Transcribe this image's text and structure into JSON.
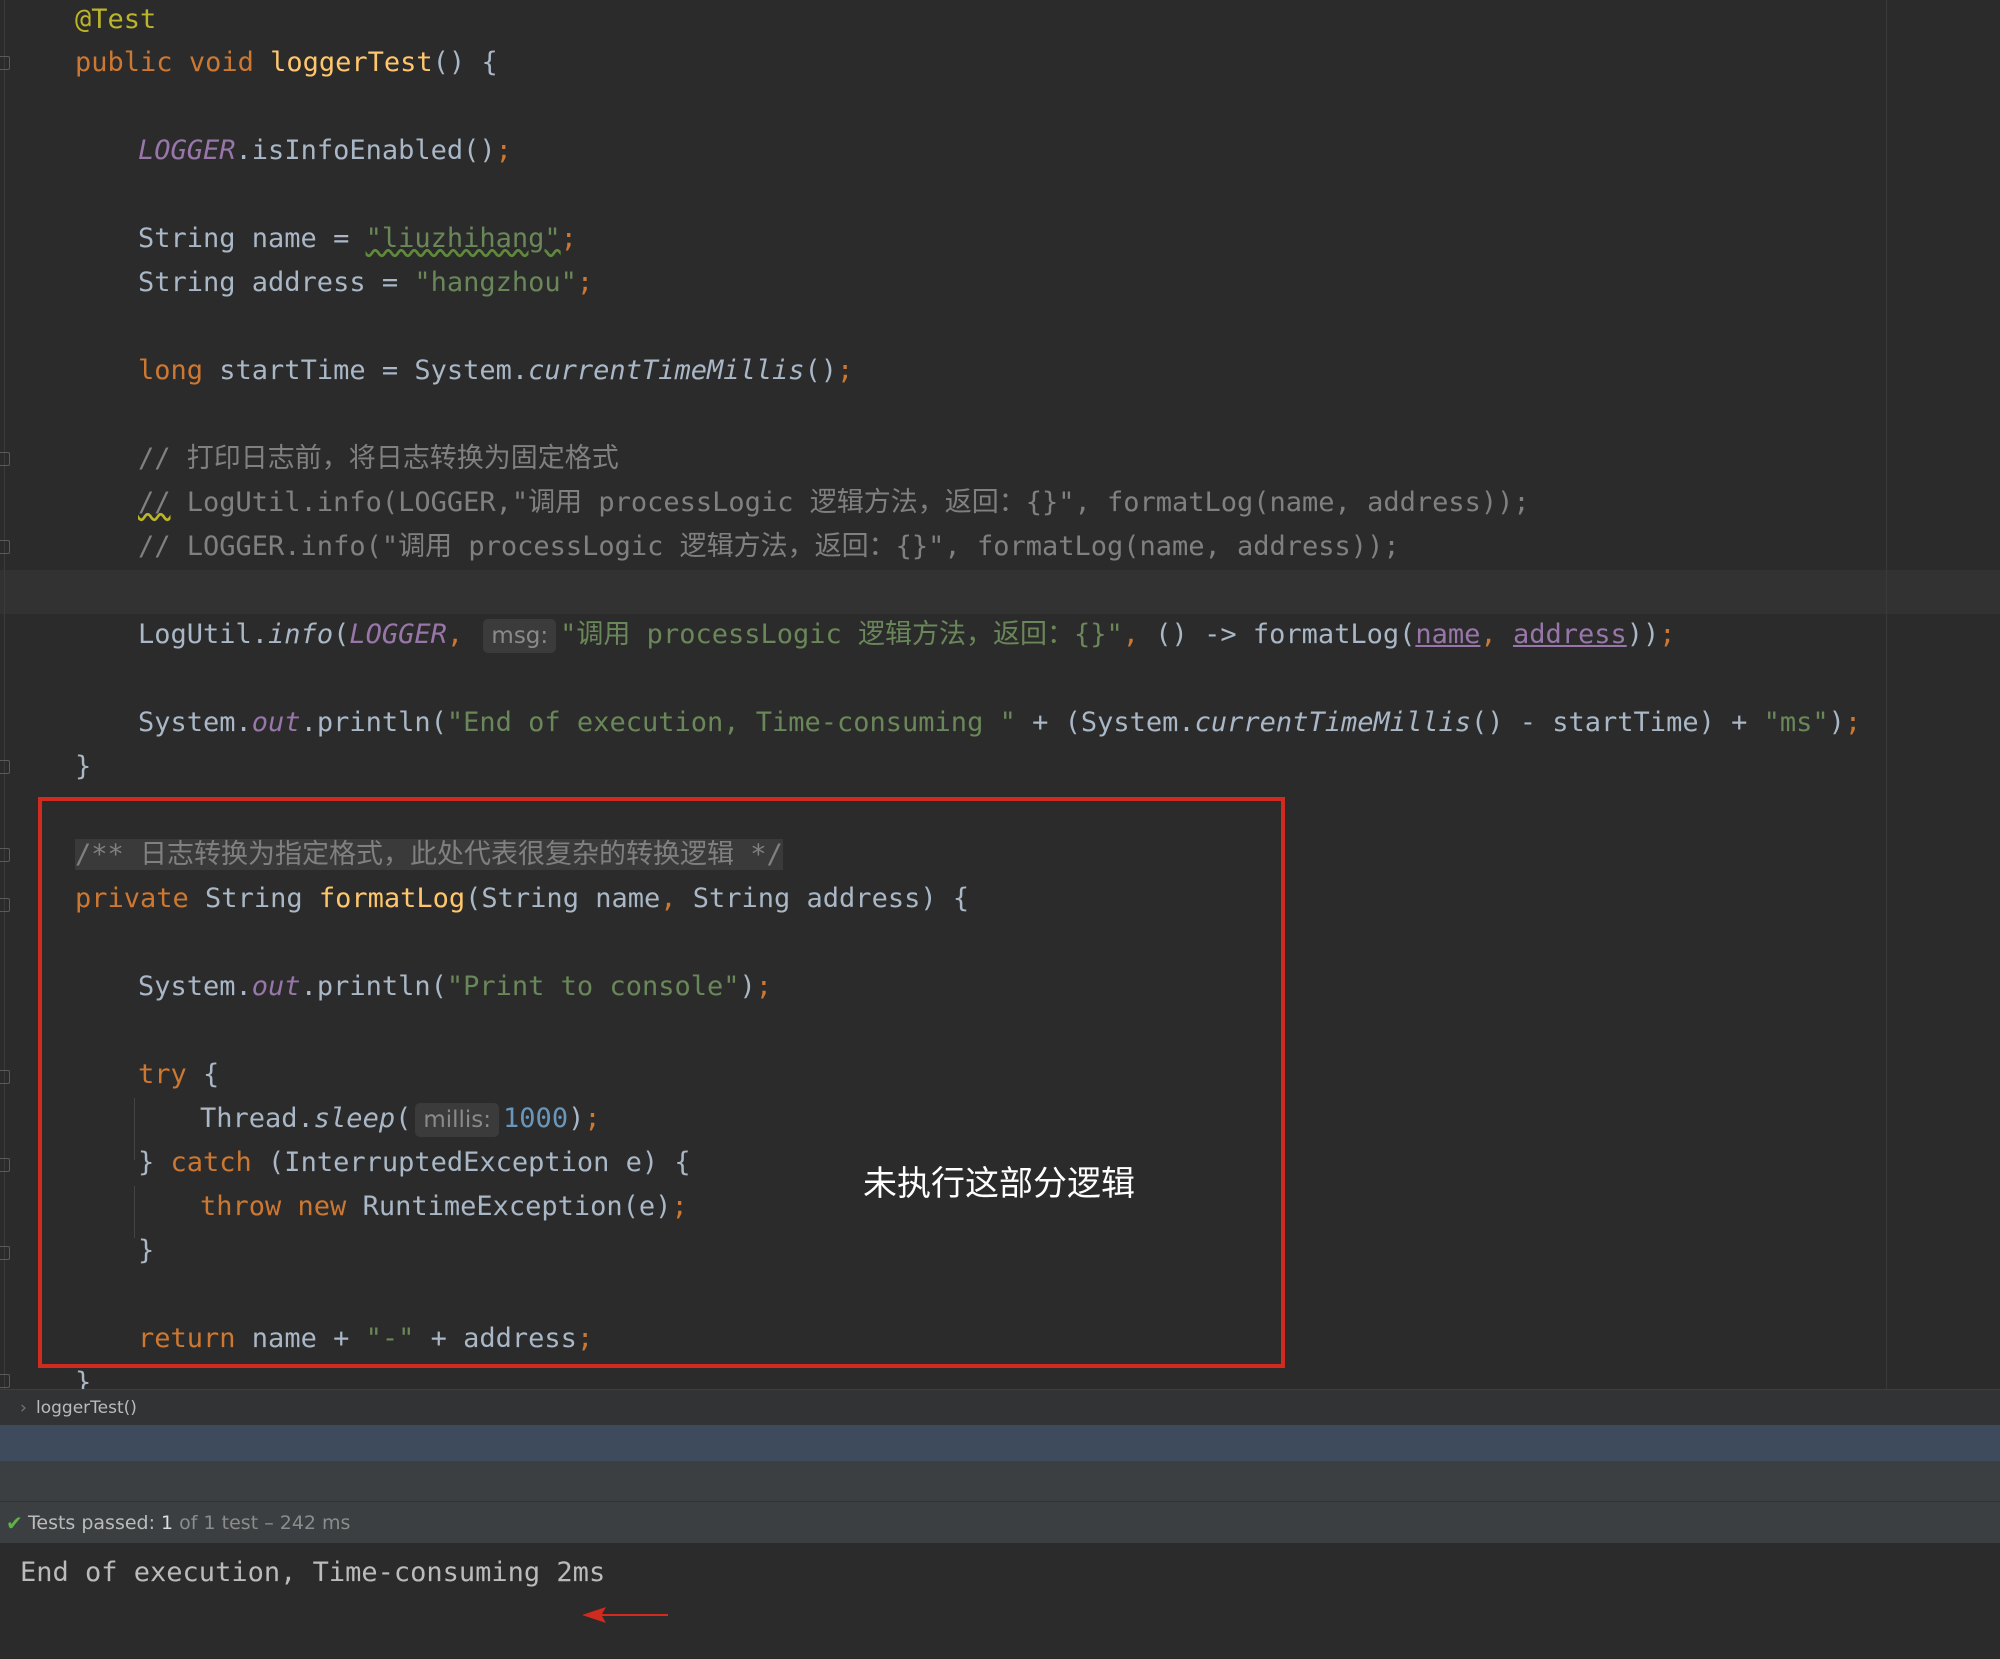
{
  "editor": {
    "lines": {
      "l1": {
        "annotation": "@Test"
      },
      "l2": {
        "kw1": "public",
        "kw2": "void",
        "method": "loggerTest",
        "rest": "() {"
      },
      "l3": {
        "field": "LOGGER",
        "rest": ".isInfoEnabled()",
        "semi": ";"
      },
      "l4": {
        "a": "String name = ",
        "str": "\"liuzhihang\"",
        "semi": ";"
      },
      "l5": {
        "a": "String address = ",
        "str": "\"hangzhou\"",
        "semi": ";"
      },
      "l6": {
        "kw": "long",
        "a": " startTime = System.",
        "it": "currentTimeMillis",
        "b": "()",
        "semi": ";"
      },
      "l7": {
        "cmt": "// 打印日志前，将日志转换为固定格式"
      },
      "l8": {
        "slashes": "//",
        "cmt": " LogUtil.info(LOGGER,\"调用 processLogic 逻辑方法，返回：{}\", formatLog(name, address));"
      },
      "l9": {
        "cmt": "// LOGGER.info(\"调用 processLogic 逻辑方法，返回：{}\", formatLog(name, address));"
      },
      "l10": {
        "a": "LogUtil.",
        "it": "info",
        "b": "(",
        "field": "LOGGER",
        "comma": ",",
        "hint": "msg:",
        "str": "\"调用 processLogic 逻辑方法，返回：{}\"",
        "comma2": ",",
        "c": " () -> formatLog(",
        "p1": "name",
        "comma3": ",",
        "p2": "address",
        "d": "))",
        "semi": ";"
      },
      "l11": {
        "a": "System.",
        "field": "out",
        "b": ".println(",
        "str": "\"End of execution, Time-consuming \"",
        "c": " + (System.",
        "it": "currentTimeMillis",
        "d": "() - startTime) + ",
        "str2": "\"ms\"",
        "e": ")",
        "semi": ";"
      },
      "l12": {
        "brace": "}"
      },
      "l13": {
        "doc": "/** 日志转换为指定格式，此处代表很复杂的转换逻辑 */"
      },
      "l14": {
        "kw": "private",
        "a": " String ",
        "method": "formatLog",
        "b": "(String name",
        "comma": ",",
        "c": " String address) {"
      },
      "l15": {
        "a": "System.",
        "field": "out",
        "b": ".println(",
        "str": "\"Print to console\"",
        "c": ")",
        "semi": ";"
      },
      "l16": {
        "kw": "try",
        "rest": " {"
      },
      "l17": {
        "a": "Thread.",
        "it": "sleep",
        "b": "(",
        "hint": "millis:",
        "num": "1000",
        "c": ")",
        "semi": ";"
      },
      "l18": {
        "a": "} ",
        "kw": "catch",
        "b": " (InterruptedException e) {"
      },
      "l19": {
        "kw1": "throw",
        "kw2": "new",
        "a": " RuntimeException(e)",
        "semi": ";"
      },
      "l20": {
        "brace": "}"
      },
      "l21": {
        "kw": "return",
        "a": " name + ",
        "str": "\"-\"",
        "b": " + address",
        "semi": ";"
      },
      "l22": {
        "brace": "}"
      }
    },
    "annotation_label": "未执行这部分逻辑"
  },
  "breadcrumb": {
    "separator": "›",
    "label": "loggerTest()"
  },
  "test_status": {
    "check": "✔",
    "prefix": "Tests passed: ",
    "count": "1",
    "detail": " of 1 test – 242 ms"
  },
  "console": {
    "output": "End of execution, Time-consuming 2ms"
  },
  "colors": {
    "highlight_box": "#d12a1f",
    "arrow": "#d12a1f",
    "pass": "#5fb246"
  }
}
